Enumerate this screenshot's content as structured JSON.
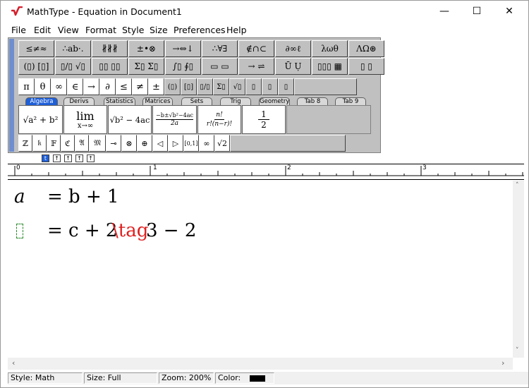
{
  "window": {
    "title": "MathType - Equation in Document1",
    "minimize": "—",
    "maximize": "☐",
    "close": "✕"
  },
  "menu": [
    "File",
    "Edit",
    "View",
    "Format",
    "Style",
    "Size",
    "Preferences",
    "Help"
  ],
  "palette_row1": [
    "≤≠≈",
    "∴ab·.",
    "∦∦∦",
    "±•⊗",
    "→⇔↓",
    "∴∀∃",
    "∉∩⊂",
    "∂∞ℓ",
    "λωθ",
    "ΛΩ⊛"
  ],
  "palette_row2": [
    "(▯) [▯]",
    "▯/▯ √▯",
    "▯▯ ▯▯",
    "Σ▯ Σ▯",
    "∫▯ ∮▯",
    "▭ ▭",
    "→ ⇌",
    "Ū Ụ",
    "▯▯▯ ▦",
    "▯ ▯"
  ],
  "symbol_row": [
    "π",
    "θ",
    "∞",
    "∈",
    "→",
    "∂",
    "≤",
    "≠",
    "±",
    "(▯)",
    "[▯]",
    "▯/▯",
    "Σ▯",
    "√▯",
    "▯",
    "▯",
    "▯"
  ],
  "tabs": [
    "Algebra",
    "Derivs",
    "Statistics",
    "Matrices",
    "Sets",
    "Trig",
    "Geometry",
    "Tab 8",
    "Tab 9"
  ],
  "templates": {
    "t1": "√a² + b²",
    "t2_top": "lim",
    "t2_bottom": "x→∞",
    "t3": "√b² − 4ac",
    "t4_top": "−b±√b²−4ac",
    "t4_bottom": "2a",
    "t5_top": "n!",
    "t5_bottom": "r!(n−r)!",
    "t6_top": "1",
    "t6_bottom": "2"
  },
  "small_row": [
    "ℤ",
    "𝔨",
    "𝔽",
    "ℭ",
    "𝔄",
    "𝔐",
    "⊸",
    "⊗",
    "⊕",
    "◁",
    "▷",
    "[0,1]",
    "∞",
    "√2"
  ],
  "tiny_buttons": [
    "t",
    "↑",
    "↑",
    "↑",
    "↑"
  ],
  "ruler_numbers": [
    "0",
    "1",
    "2",
    "3"
  ],
  "equations": {
    "line1_lhs": "a",
    "line1_rhs": "= b + 1",
    "line2_rhs": "= c + 2",
    "line2_tag": "\\tag",
    "line2_after": "3 − 2"
  },
  "status": {
    "style": "Style: Math",
    "size": "Size: Full",
    "zoom": "Zoom: 200%",
    "color_label": "Color:",
    "color_value": "#000000"
  },
  "colors": {
    "accent": "#1e5fd8",
    "tag_red": "#e02020",
    "app_icon_red": "#d4202c",
    "toolbar_bg": "#c0c0c0"
  }
}
